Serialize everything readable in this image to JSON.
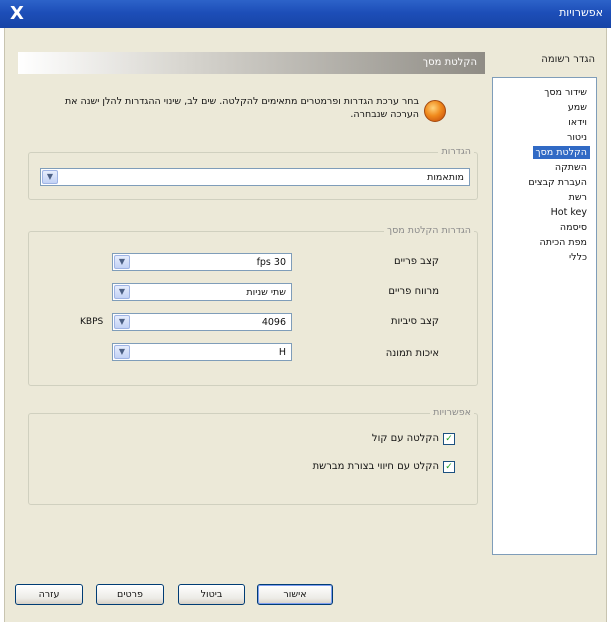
{
  "window": {
    "title": "אפשרויות",
    "close_glyph": "X"
  },
  "nav": {
    "heading": "הגדר רשומה",
    "items": [
      {
        "label": "שידור מסך"
      },
      {
        "label": "שמע"
      },
      {
        "label": "וידאו"
      },
      {
        "label": "ניטור"
      },
      {
        "label": "הקלטת מסך",
        "selected": true
      },
      {
        "label": "השתקה"
      },
      {
        "label": "העברת קבצים"
      },
      {
        "label": "רשת"
      },
      {
        "label": "Hot key"
      },
      {
        "label": "סיסמה"
      },
      {
        "label": "מפת הכיתה"
      },
      {
        "label": "כללי"
      }
    ]
  },
  "main": {
    "header_title": "הקלטת מסך",
    "info_icon": "info-orb-icon",
    "info_text": "בחר ערכת הגדרות ופרמטרים מתאימים להקלטה. שים לב, שינוי ההגדרות להלן ישנה את הערכה שנבחרה.",
    "settings_group": {
      "label": "הגדרות",
      "preset_value": "מותאמות"
    },
    "recording_group": {
      "label": "הגדרות הקלטת מסך",
      "fields": [
        {
          "label": "קצב פריים",
          "value": "fps 30",
          "unit": ""
        },
        {
          "label": "מרווח פריים",
          "value": "שתי שניות",
          "unit": ""
        },
        {
          "label": "קצב סיביות",
          "value": "4096",
          "unit": "KBPS"
        },
        {
          "label": "איכות תמונה",
          "value": "H",
          "unit": ""
        }
      ]
    },
    "options_group": {
      "label": "אפשרויות",
      "options": [
        {
          "label": "הקלטה עם קול",
          "checked": true
        },
        {
          "label": "הקלט עם חיווי בצורת מברשת",
          "checked": true
        }
      ]
    }
  },
  "buttons": {
    "ok": "אישור",
    "cancel": "ביטול",
    "details": "פרטים",
    "help": "עזרה"
  },
  "colors": {
    "titlebar": "#1d4eb8",
    "selection": "#316ac5",
    "dialog_bg": "#ece9d8"
  }
}
